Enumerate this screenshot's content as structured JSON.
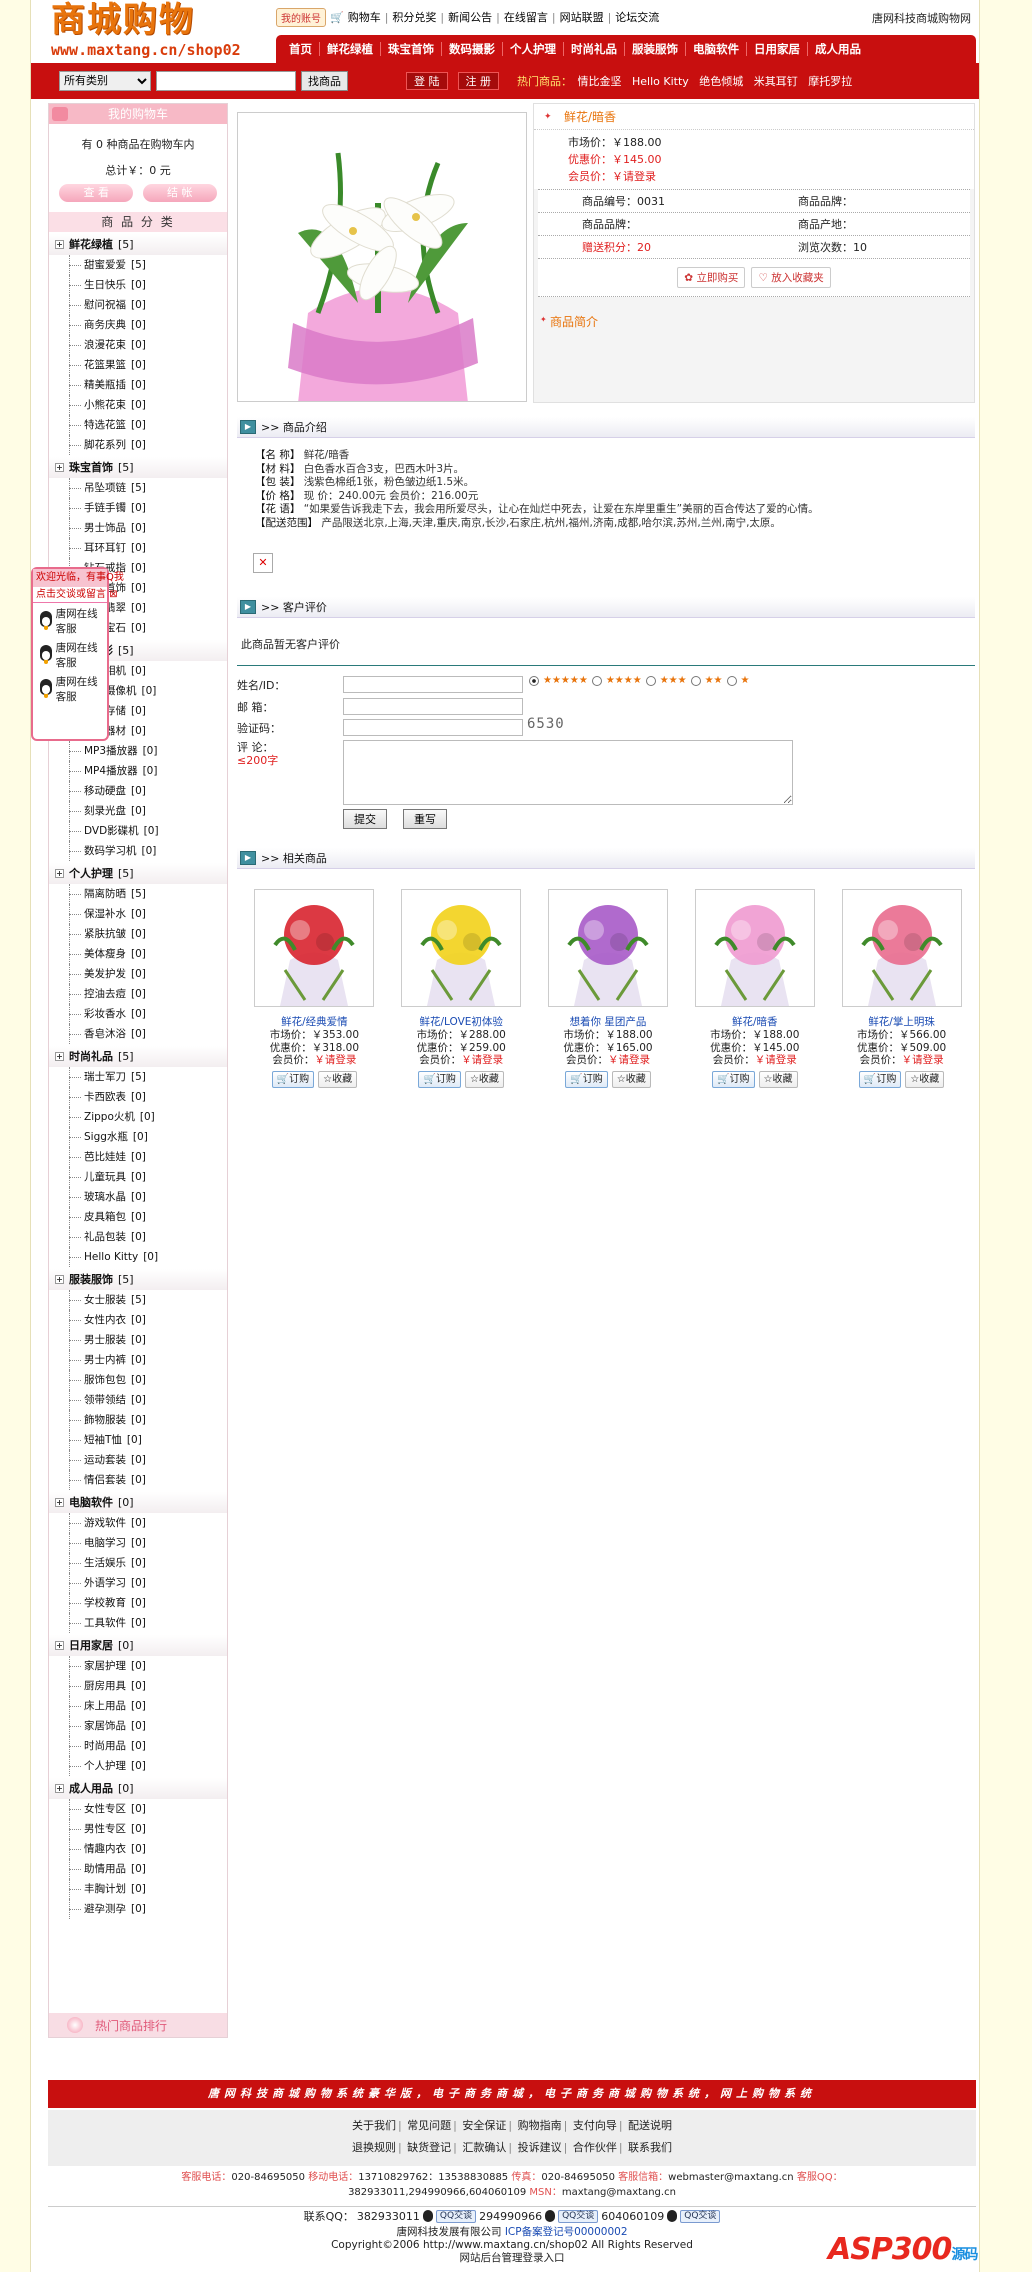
{
  "header": {
    "logo_title": "商城购物",
    "logo_url": "www.maxtang.cn/shop02",
    "my_account": "我的账号",
    "toplinks": [
      "购物车",
      "积分兑奖",
      "新闻公告",
      "在线留言",
      "网站联盟",
      "论坛交流"
    ],
    "company": "唐网科技商城购物网",
    "nav": [
      "首页",
      "鲜花绿植",
      "珠宝首饰",
      "数码摄影",
      "个人护理",
      "时尚礼品",
      "服装服饰",
      "电脑软件",
      "日用家居",
      "成人用品"
    ]
  },
  "searchbar": {
    "category": "所有类别",
    "search_btn": "找商品",
    "login": "登 陆",
    "register": "注 册",
    "hot_label": "热门商品：",
    "hot_items": [
      "情比金坚",
      "Hello Kitty",
      "绝色倾城",
      "米其耳钉",
      "摩托罗拉"
    ]
  },
  "cart": {
    "title": "我的购物车",
    "line": "有 0 种商品在购物车内",
    "total": "总计￥：0 元",
    "view": "查 看",
    "checkout": "结 帐"
  },
  "categories": {
    "title": "商 品 分 类",
    "groups": [
      {
        "name": "鲜花绿植",
        "count": "[5]",
        "items": [
          [
            "甜蜜爱爱",
            "[5]"
          ],
          [
            "生日快乐",
            "[0]"
          ],
          [
            "慰问祝福",
            "[0]"
          ],
          [
            "商务庆典",
            "[0]"
          ],
          [
            "浪漫花束",
            "[0]"
          ],
          [
            "花篮果篮",
            "[0]"
          ],
          [
            "精美瓶插",
            "[0]"
          ],
          [
            "小熊花束",
            "[0]"
          ],
          [
            "特选花篮",
            "[0]"
          ],
          [
            "脚花系列",
            "[0]"
          ]
        ]
      },
      {
        "name": "珠宝首饰",
        "count": "[5]",
        "items": [
          [
            "吊坠项链",
            "[5]"
          ],
          [
            "手链手镯",
            "[0]"
          ],
          [
            "男士饰品",
            "[0]"
          ],
          [
            "耳环耳钉",
            "[0]"
          ],
          [
            "钻石戒指",
            "[0]"
          ],
          [
            "珍珠首饰",
            "[0]"
          ],
          [
            "玉石翡翠",
            "[0]"
          ],
          [
            "流行宝石",
            "[0]"
          ]
        ]
      },
      {
        "name": "数码摄影",
        "count": "[5]",
        "items": [
          [
            "数码相机",
            "[0]"
          ],
          [
            "数码摄像机",
            "[0]"
          ],
          [
            "影像存储",
            "[0]"
          ],
          [
            "专用器材",
            "[0]"
          ],
          [
            "MP3播放器",
            "[0]"
          ],
          [
            "MP4播放器",
            "[0]"
          ],
          [
            "移动硬盘",
            "[0]"
          ],
          [
            "刻录光盘",
            "[0]"
          ],
          [
            "DVD影碟机",
            "[0]"
          ],
          [
            "数码学习机",
            "[0]"
          ]
        ]
      },
      {
        "name": "个人护理",
        "count": "[5]",
        "items": [
          [
            "隔离防晒",
            "[5]"
          ],
          [
            "保湿补水",
            "[0]"
          ],
          [
            "紧肤抗皱",
            "[0]"
          ],
          [
            "美体瘦身",
            "[0]"
          ],
          [
            "美发护发",
            "[0]"
          ],
          [
            "控油去痘",
            "[0]"
          ],
          [
            "彩妆香水",
            "[0]"
          ],
          [
            "香皂沐浴",
            "[0]"
          ]
        ]
      },
      {
        "name": "时尚礼品",
        "count": "[5]",
        "items": [
          [
            "瑞士军刀",
            "[5]"
          ],
          [
            "卡西欧表",
            "[0]"
          ],
          [
            "Zippo火机",
            "[0]"
          ],
          [
            "Sigg水瓶",
            "[0]"
          ],
          [
            "芭比娃娃",
            "[0]"
          ],
          [
            "儿童玩具",
            "[0]"
          ],
          [
            "玻璃水晶",
            "[0]"
          ],
          [
            "皮具箱包",
            "[0]"
          ],
          [
            "礼品包装",
            "[0]"
          ],
          [
            "Hello Kitty",
            "[0]"
          ]
        ]
      },
      {
        "name": "服装服饰",
        "count": "[5]",
        "items": [
          [
            "女士服装",
            "[5]"
          ],
          [
            "女性内衣",
            "[0]"
          ],
          [
            "男士服装",
            "[0]"
          ],
          [
            "男士内裤",
            "[0]"
          ],
          [
            "服饰包包",
            "[0]"
          ],
          [
            "领带领结",
            "[0]"
          ],
          [
            "飾物服装",
            "[0]"
          ],
          [
            "短袖T恤",
            "[0]"
          ],
          [
            "运动套装",
            "[0]"
          ],
          [
            "情侣套装",
            "[0]"
          ]
        ]
      },
      {
        "name": "电脑软件",
        "count": "[0]",
        "items": [
          [
            "游戏软件",
            "[0]"
          ],
          [
            "电脑学习",
            "[0]"
          ],
          [
            "生活娱乐",
            "[0]"
          ],
          [
            "外语学习",
            "[0]"
          ],
          [
            "学校教育",
            "[0]"
          ],
          [
            "工具软件",
            "[0]"
          ]
        ]
      },
      {
        "name": "日用家居",
        "count": "[0]",
        "items": [
          [
            "家居护理",
            "[0]"
          ],
          [
            "厨房用具",
            "[0]"
          ],
          [
            "床上用品",
            "[0]"
          ],
          [
            "家居饰品",
            "[0]"
          ],
          [
            "时尚用品",
            "[0]"
          ],
          [
            "个人护理",
            "[0]"
          ]
        ]
      },
      {
        "name": "成人用品",
        "count": "[0]",
        "items": [
          [
            "女性专区",
            "[0]"
          ],
          [
            "男性专区",
            "[0]"
          ],
          [
            "情趣内衣",
            "[0]"
          ],
          [
            "助情用品",
            "[0]"
          ],
          [
            "丰胸计划",
            "[0]"
          ],
          [
            "避孕测孕",
            "[0]"
          ]
        ]
      }
    ],
    "hot_rank": "热门商品排行"
  },
  "qq_float": {
    "welcome": "欢迎光临，有事Q我",
    "click": "点击交谈或留言",
    "agents": [
      "唐网在线客服",
      "唐网在线客服",
      "唐网在线客服"
    ]
  },
  "product": {
    "title": "鲜花/暗香",
    "market": "市场价：￥188.00",
    "sale": "优惠价：￥145.00",
    "member": "会员价：￥请登录",
    "specs": [
      [
        "商品编号：0031",
        "商品品牌："
      ],
      [
        "商品品牌：",
        "商品产地："
      ],
      [
        "赠送积分：20",
        "浏览次数：10"
      ]
    ],
    "buy": "立即购买",
    "fav": "放入收藏夹",
    "intro_link": "商品简介"
  },
  "sections": {
    "intro": ">> 商品介绍",
    "review": ">> 客户评价",
    "related": ">> 相关商品"
  },
  "intro": {
    "lines": [
      [
        "【名  称】",
        "鲜花/暗香"
      ],
      [
        "【材  料】",
        "白色香水百合3支，巴西木叶3片。"
      ],
      [
        "【包  装】",
        "浅紫色棉纸1张，粉色皱边纸1.5米。"
      ],
      [
        "【价  格】",
        "现  价：240.00元  会员价：216.00元"
      ],
      [
        "【花  语】",
        "“如果爱告诉我走下去，我会用所爱尽头，让心在灿烂中死去，让爱在东岸里重生”美丽的百合传达了爱的心情。"
      ],
      [
        "【配送范围】",
        "产品限送北京,上海,天津,重庆,南京,长沙,石家庄,杭州,福州,济南,成都,哈尔滨,苏州,兰州,南宁,太原。"
      ]
    ]
  },
  "review": {
    "none": "此商品暂无客户评价",
    "name_label": "姓名/ID：",
    "email_label": "邮  箱：",
    "code_label": "验证码：",
    "comment_label": "评  论：",
    "limit": "≤200字",
    "captcha": "6530",
    "stars": [
      "★★★★★",
      "★★★★",
      "★★★",
      "★★",
      "★"
    ],
    "submit": "提交",
    "reset": "重写"
  },
  "related": [
    {
      "name": "鲜花/经典爱情",
      "market": "市场价：￥353.00",
      "sale": "优惠价：￥318.00",
      "member_label": "会员价：",
      "member_val": "￥请登录",
      "color": "#d8232f"
    },
    {
      "name": "鲜花/LOVE初体验",
      "market": "市场价：￥288.00",
      "sale": "优惠价：￥259.00",
      "member_label": "会员价：",
      "member_val": "￥请登录",
      "color": "#f2d21a"
    },
    {
      "name": "想着你 星团产品",
      "market": "市场价：￥188.00",
      "sale": "优惠价：￥165.00",
      "member_label": "会员价：",
      "member_val": "￥请登录",
      "color": "#a75ac8"
    },
    {
      "name": "鲜花/暗香",
      "market": "市场价：￥188.00",
      "sale": "优惠价：￥145.00",
      "member_label": "会员价：",
      "member_val": "￥请登录",
      "color": "#f09ad0"
    },
    {
      "name": "鲜花/掌上明珠",
      "market": "市场价：￥566.00",
      "sale": "优惠价：￥509.00",
      "member_label": "会员价：",
      "member_val": "￥请登录",
      "color": "#e96b8e"
    }
  ],
  "related_btns": {
    "order": "订购",
    "fav": "收藏"
  },
  "footer": {
    "banner": "唐网科技商城购物系统豪华版，电子商务商城，电子商务商城购物系统，网上购物系统",
    "nav1": [
      "关于我们",
      "常见问题",
      "安全保证",
      "购物指南",
      "支付向导",
      "配送说明"
    ],
    "nav2": [
      "退换规则",
      "缺货登记",
      "汇款确认",
      "投诉建议",
      "合作伙伴",
      "联系我们"
    ],
    "c1_k": "客服电话：",
    "c1_v": "020-84695050",
    "c2_k": "移动电话：",
    "c2_v": "13710829762：13538830885",
    "c3_k": "传真：",
    "c3_v": "020-84695050",
    "c4_k": "客服信箱：",
    "c4_v": "webmaster@maxtang.cn",
    "c5_k": "客服QQ：",
    "c5_v": "382933011,294990966,604060109",
    "c6_k": "MSN：",
    "c6_v": "maxtang@maxtang.cn",
    "qq_label": "联系QQ：",
    "qq_nums": [
      "382933011",
      "294990966",
      "604060109"
    ],
    "qq_tag": "QQ交谈",
    "company": "唐网科技发展有限公司",
    "icp": "ICP备案登记号00000002",
    "copyright": "Copyright©2006 http://www.maxtang.cn/shop02 All Rights Reserved",
    "admin": "网站后台管理登录入口"
  },
  "watermark": {
    "main": "ASP300",
    "sub": "源码"
  }
}
